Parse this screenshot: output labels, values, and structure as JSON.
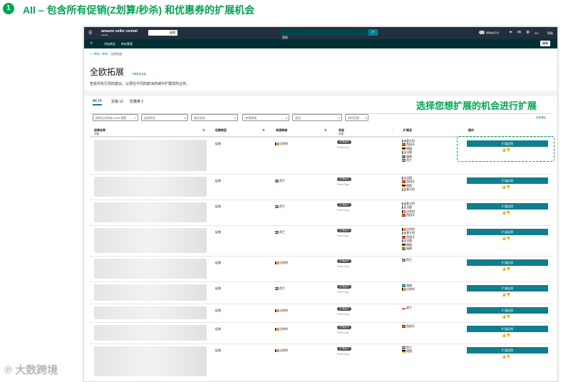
{
  "slide": {
    "step_number": "1",
    "heading": "All – 包含所有促销(Z划算/秒杀) 和优惠券的扩展机会",
    "callout": "选择您想扩展的机会进行扩展",
    "watermark": "大数跨境"
  },
  "topbar": {
    "logo": "amazon seller central",
    "logo_sub": "europe",
    "store": "英国",
    "search_placeholder": "搜索",
    "right_items": [
      "顾客信息平台",
      "ZH",
      "帮助"
    ]
  },
  "subnav": {
    "items": [
      "添加商品",
      "库存管理"
    ],
    "edit": "编辑"
  },
  "breadcrumb": [
    "库存",
    "库存",
    "全欧拓展"
  ],
  "page": {
    "title": "全欧拓展",
    "learn_more": "了解更多信息",
    "description": "查看并执行您的建议，以便在不同的欧洲商城中扩展您的业务。"
  },
  "tabs": [
    {
      "label": "All 14",
      "active": true
    },
    {
      "label": "交易 12",
      "active": false
    },
    {
      "label": "优惠券 2",
      "active": false
    }
  ],
  "filters": {
    "search_placeholder": "按商品名称或 ASIN 搜索",
    "dropdowns": [
      "促销状态",
      "建议状态",
      "来源商城",
      "类型",
      "时间范围"
    ],
    "clear": "全部清除"
  },
  "columns": [
    "促销名称",
    "促销类型",
    "来源商城",
    "状态",
    "扩展至",
    "操作"
  ],
  "column_sub": {
    "name": "详情",
    "status": "历程"
  },
  "rows": [
    {
      "type": "促销",
      "source": "比利时",
      "status": "正常运行",
      "event": "Prime Day",
      "markets": [
        "意大利",
        "西班牙",
        "德国",
        "法国",
        "瑞典",
        "荷兰"
      ]
    },
    {
      "type": "促销",
      "source": "荷兰",
      "status": "正常运行",
      "event": "Prime Day",
      "markets": [
        "法国",
        "西班牙",
        "德国",
        "意大利"
      ]
    },
    {
      "type": "促销",
      "source": "荷兰",
      "status": "正常运行",
      "event": "Prime Day",
      "markets": [
        "意大利",
        "法国",
        "比利时",
        "西班牙"
      ]
    },
    {
      "type": "促销",
      "source": "荷兰",
      "status": "正常运行",
      "event": "Prime Day",
      "markets": [
        "比利时",
        "意大利",
        "西班牙",
        "法国",
        "德国",
        "瑞典"
      ]
    },
    {
      "type": "促销",
      "source": "比利时",
      "status": "正常运行",
      "event": "Prime Day",
      "markets": [
        "荷兰"
      ]
    },
    {
      "type": "促销",
      "source": "荷兰",
      "status": "正常运行",
      "event": "Prime Day",
      "markets": [
        "瑞典",
        "比利时"
      ]
    },
    {
      "type": "促销",
      "source": "比利时",
      "status": "正常运行",
      "event": "Prime Day",
      "markets": [
        "波兰"
      ]
    },
    {
      "type": "促销",
      "source": "比利时",
      "status": "正常运行",
      "event": "Prime Day",
      "markets": [
        "西班牙"
      ]
    },
    {
      "type": "促销",
      "source": "比利时",
      "status": "正常运行",
      "event": "Prime Day",
      "markets": [
        "荷兰",
        "德国"
      ]
    }
  ],
  "action": {
    "label": "扩展促销",
    "like": "👍",
    "dislike": "👎"
  }
}
